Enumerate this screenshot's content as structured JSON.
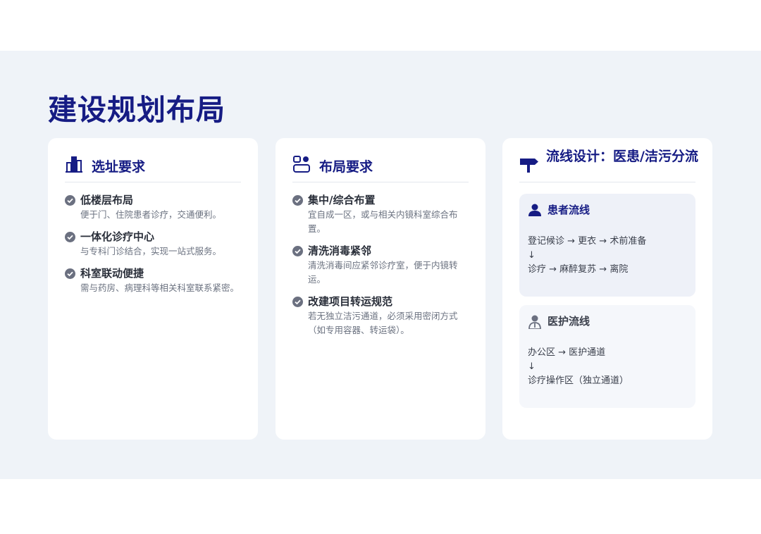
{
  "title": "建设规划布局",
  "cards": [
    {
      "icon": "building-icon",
      "title": "选址要求",
      "items": [
        {
          "title": "低楼层布局",
          "desc": "便于门、住院患者诊疗，交通便利。"
        },
        {
          "title": "一体化诊疗中心",
          "desc": "与专科门诊结合，实现一站式服务。"
        },
        {
          "title": "科室联动便捷",
          "desc": "需与药房、病理科等相关科室联系紧密。"
        }
      ]
    },
    {
      "icon": "layout-icon",
      "title": "布局要求",
      "items": [
        {
          "title": "集中/综合布置",
          "desc": "宜自成一区，或与相关内镜科室综合布置。"
        },
        {
          "title": "清洗消毒紧邻",
          "desc": "清洗消毒间应紧邻诊疗室，便于内镜转运。"
        },
        {
          "title": "改建项目转运规范",
          "desc": "若无独立洁污通道，必须采用密闭方式（如专用容器、转运袋）。"
        }
      ]
    },
    {
      "icon": "signpost-icon",
      "title": "流线设计：医患/洁污分流",
      "flows": [
        {
          "icon": "person-icon",
          "title": "患者流线",
          "line1": "登记候诊 → 更衣 → 术前准备",
          "arrow": "↓",
          "line2": "诊疗 → 麻醉复苏 → 离院"
        },
        {
          "icon": "doctor-icon",
          "title": "医护流线",
          "line1": "办公区 → 医护通道",
          "arrow": "↓",
          "line2": "诊疗操作区（独立通道）"
        }
      ]
    }
  ],
  "colors": {
    "accent": "#161c84",
    "background": "#eff3f8",
    "check": "#6b7080"
  }
}
